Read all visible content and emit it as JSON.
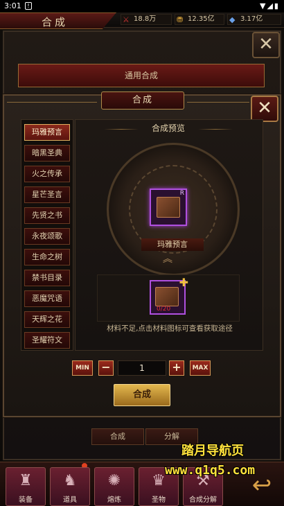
{
  "status_bar": {
    "time": "3:01",
    "notification": "!",
    "icons": "▼◢▮"
  },
  "header": {
    "title": "合成",
    "resources": [
      {
        "icon": "scroll-icon",
        "glyph": "⚔",
        "value": "18.8万"
      },
      {
        "icon": "gold-icon",
        "glyph": "⛃",
        "value": "12.35亿"
      },
      {
        "icon": "diamond-icon",
        "glyph": "◆",
        "value": "3.17亿"
      }
    ]
  },
  "back_panel": {
    "bar_label": "通用合成",
    "close_glyph": "✕"
  },
  "modal": {
    "title": "合成",
    "close_glyph": "✕",
    "categories": [
      "玛雅预言",
      "暗黑圣典",
      "火之传承",
      "星芒圣言",
      "先贤之书",
      "永夜颂歌",
      "生命之树",
      "禁书目录",
      "恶魔咒语",
      "天辉之花",
      "圣耀符文"
    ],
    "active_category": "玛雅预言",
    "preview": {
      "title": "合成预览",
      "target_name": "玛雅预言",
      "target_quality": "R",
      "chevrons": "︽",
      "material_count": "0/20",
      "material_plus": "✚",
      "hint": "材料不足,点击材料图标可查看获取途径"
    },
    "quantity": {
      "min_label": "MIN",
      "minus_label": "−",
      "value": "1",
      "plus_label": "+",
      "max_label": "MAX"
    },
    "craft_label": "合成"
  },
  "sub_tabs": [
    "合成",
    "分解"
  ],
  "bottom_nav": [
    {
      "label": "装备",
      "icon": "helmet-icon",
      "glyph": "♜"
    },
    {
      "label": "道具",
      "icon": "warrior-icon",
      "glyph": "♞"
    },
    {
      "label": "熔炼",
      "icon": "flame-icon",
      "glyph": "✺"
    },
    {
      "label": "圣物",
      "icon": "relic-icon",
      "glyph": "♛"
    },
    {
      "label": "合成分解",
      "icon": "anvil-icon",
      "glyph": "⚒"
    }
  ],
  "corner_arrow": "↩",
  "watermark": {
    "line1": "踏月导航页",
    "line2": "www.q1q5.com"
  },
  "colors": {
    "accent_red": "#8c2a1c",
    "gold": "#e3b74e",
    "purple_quality": "#b050e0"
  }
}
